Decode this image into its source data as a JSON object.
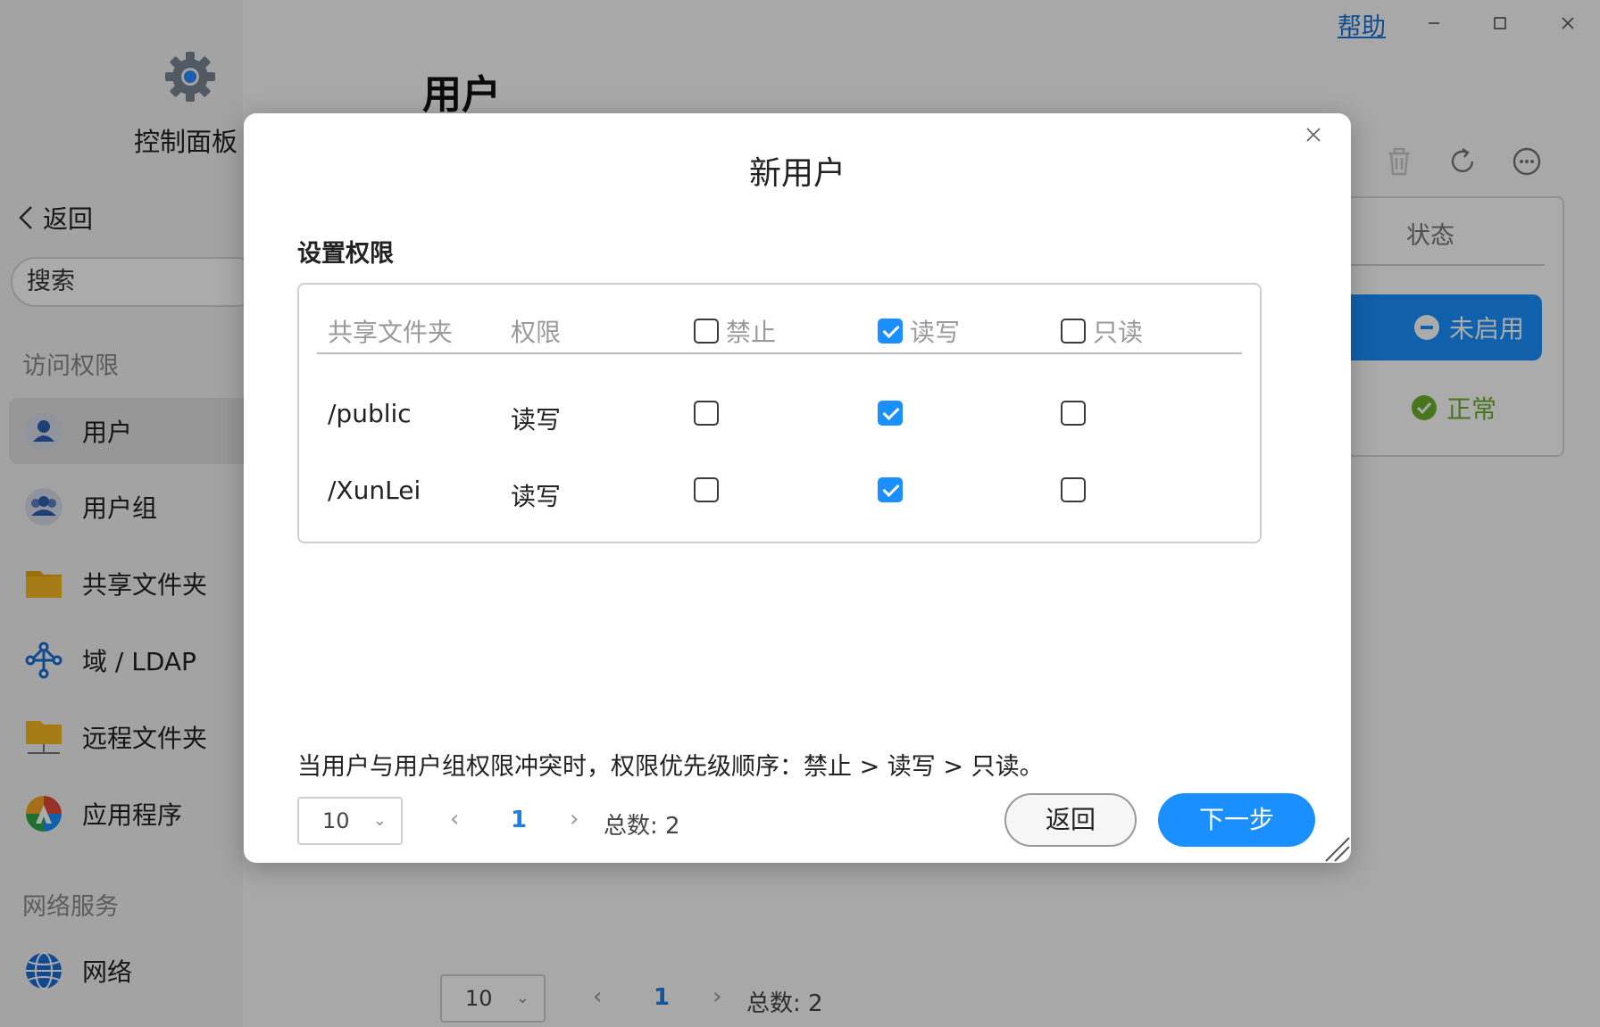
{
  "window": {
    "help_label": "帮助"
  },
  "sidebar": {
    "title": "控制面板",
    "back_label": "返回",
    "search_placeholder": "搜索",
    "section_access": "访问权限",
    "section_network": "网络服务",
    "items": [
      {
        "label": "用户",
        "icon": "user-icon",
        "active": true
      },
      {
        "label": "用户组",
        "icon": "user-group-icon"
      },
      {
        "label": "共享文件夹",
        "icon": "folder-icon"
      },
      {
        "label": "域 / LDAP",
        "icon": "ldap-icon"
      },
      {
        "label": "远程文件夹",
        "icon": "remote-folder-icon"
      },
      {
        "label": "应用程序",
        "icon": "app-icon"
      }
    ],
    "network_item": {
      "label": "网络",
      "icon": "globe-icon"
    }
  },
  "main": {
    "title": "用户",
    "status_header": "状态",
    "status_disabled": "未启用",
    "status_normal": "正常",
    "pager": {
      "page_size": "10",
      "current_page": "1",
      "total_label": "总数: 2"
    }
  },
  "modal": {
    "title": "新用户",
    "section_title": "设置权限",
    "headers": {
      "folder": "共享文件夹",
      "permission": "权限",
      "deny": "禁止",
      "read_write": "读写",
      "read_only": "只读"
    },
    "header_checks": {
      "deny": false,
      "read_write": true,
      "read_only": false
    },
    "rows": [
      {
        "folder": "/public",
        "permission": "读写",
        "deny": false,
        "read_write": true,
        "read_only": false
      },
      {
        "folder": "/XunLei",
        "permission": "读写",
        "deny": false,
        "read_write": true,
        "read_only": false
      }
    ],
    "note": "当用户与用户组权限冲突时，权限优先级顺序：禁止 > 读写 > 只读。",
    "pager": {
      "page_size": "10",
      "current_page": "1",
      "total_label": "总数: 2"
    },
    "back_button": "返回",
    "next_button": "下一步"
  },
  "colors": {
    "accent": "#1a8fff",
    "ok": "#6ab02b",
    "link": "#1a73d9"
  }
}
